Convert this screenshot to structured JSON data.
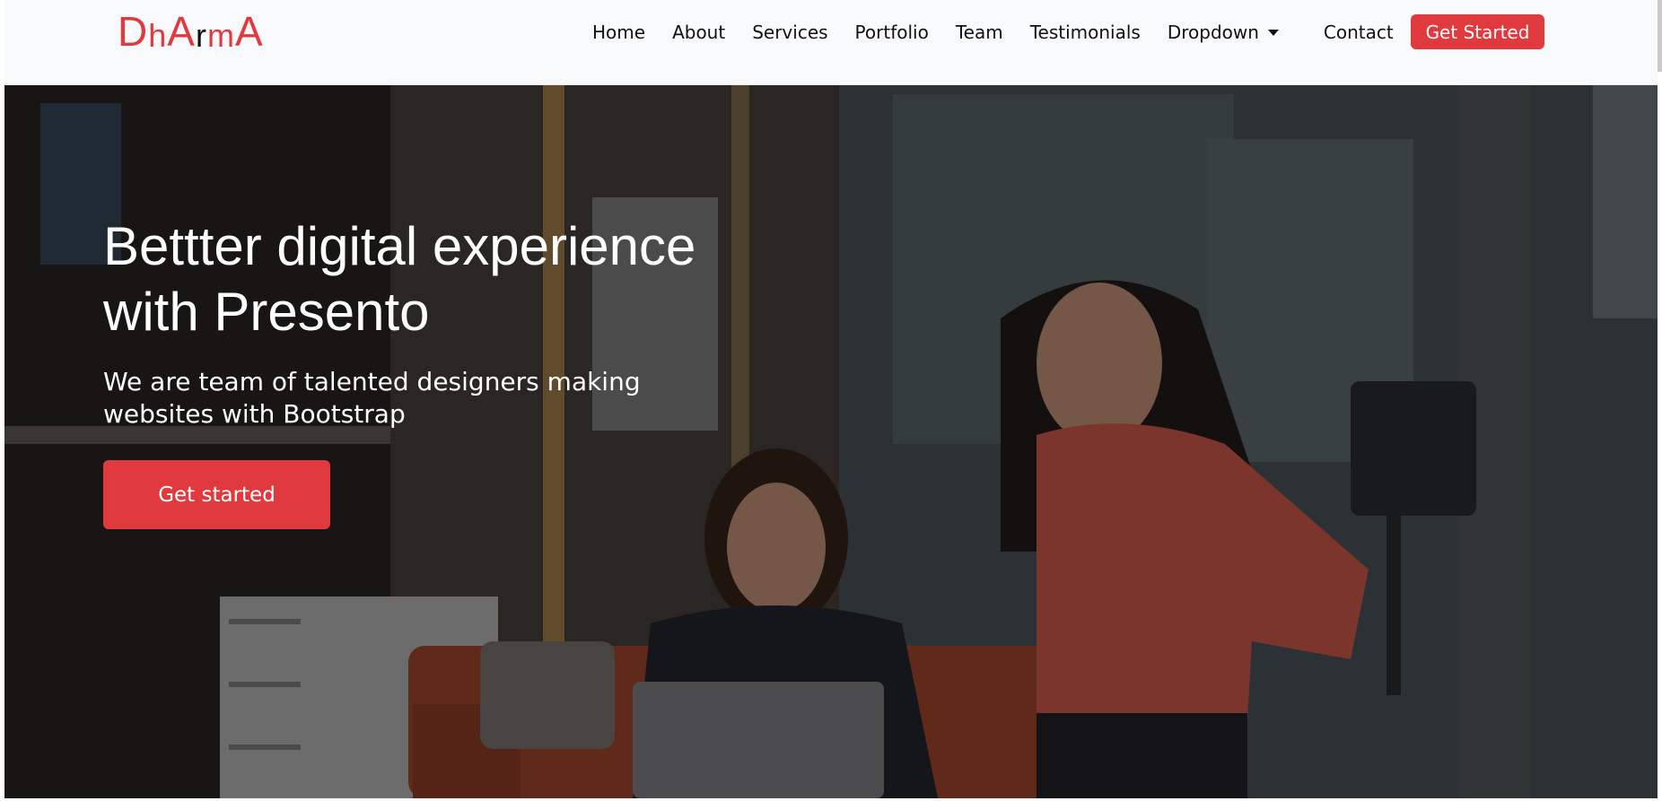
{
  "brand": {
    "name_parts": [
      "D",
      "h",
      "A",
      "r",
      "m",
      "A"
    ],
    "colors": {
      "accent": "#e03a3e",
      "dark": "#111111"
    }
  },
  "nav": {
    "items": [
      "Home",
      "About",
      "Services",
      "Portfolio",
      "Team",
      "Testimonials"
    ],
    "dropdown_label": "Dropdown",
    "contact_label": "Contact",
    "cta_label": "Get Started"
  },
  "hero": {
    "title_line1": "Bettter digital experience",
    "title_line2": "with Presento",
    "subtitle_line1": "We are team of talented designers making",
    "subtitle_line2": "websites with Bootstrap",
    "cta_label": "Get started",
    "image": "office-photo-two-women-laptop"
  }
}
